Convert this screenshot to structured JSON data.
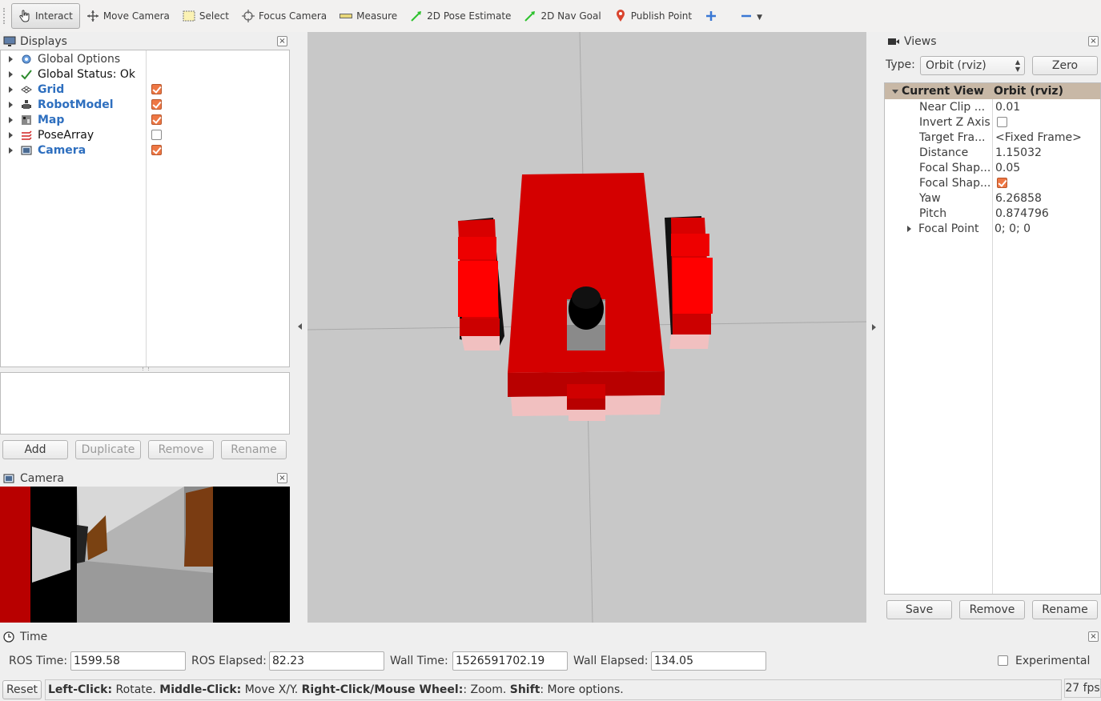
{
  "toolbar": {
    "tools": [
      {
        "label": "Interact",
        "icon": "hand-pointer-icon"
      },
      {
        "label": "Move Camera",
        "icon": "move-camera-icon"
      },
      {
        "label": "Select",
        "icon": "select-rect-icon"
      },
      {
        "label": "Focus Camera",
        "icon": "focus-camera-icon"
      },
      {
        "label": "Measure",
        "icon": "ruler-icon"
      },
      {
        "label": "2D Pose Estimate",
        "icon": "green-arrow-icon"
      },
      {
        "label": "2D Nav Goal",
        "icon": "green-arrow-icon"
      },
      {
        "label": "Publish Point",
        "icon": "map-pin-icon"
      }
    ]
  },
  "displays": {
    "title": "Displays",
    "items": [
      {
        "label": "Global Options",
        "icon": "gear-icon",
        "checked": null,
        "bold": false
      },
      {
        "label": "Global Status: Ok",
        "icon": "checkmark-icon",
        "checked": null,
        "bold": false
      },
      {
        "label": "Grid",
        "icon": "grid-icon",
        "checked": true,
        "bold": true
      },
      {
        "label": "RobotModel",
        "icon": "robot-icon",
        "checked": true,
        "bold": true
      },
      {
        "label": "Map",
        "icon": "map-icon",
        "checked": true,
        "bold": true
      },
      {
        "label": "PoseArray",
        "icon": "pose-array-icon",
        "checked": false,
        "bold": false
      },
      {
        "label": "Camera",
        "icon": "camera-icon",
        "checked": true,
        "bold": true
      }
    ],
    "buttons": {
      "add": "Add",
      "duplicate": "Duplicate",
      "remove": "Remove",
      "rename": "Rename"
    }
  },
  "camera_panel": {
    "title": "Camera"
  },
  "views": {
    "title": "Views",
    "type_label": "Type:",
    "type_value": "Orbit (rviz)",
    "zero": "Zero",
    "header": {
      "name": "Current View",
      "value": "Orbit (rviz)"
    },
    "props": [
      {
        "name": "Near Clip ...",
        "value": "0.01"
      },
      {
        "name": "Invert Z Axis",
        "value": ""
      },
      {
        "name": "Target Fra...",
        "value": "<Fixed Frame>"
      },
      {
        "name": "Distance",
        "value": "1.15032"
      },
      {
        "name": "Focal Shap...",
        "value": "0.05"
      },
      {
        "name": "Focal Shap...",
        "value": ""
      },
      {
        "name": "Yaw",
        "value": "6.26858"
      },
      {
        "name": "Pitch",
        "value": "0.874796"
      },
      {
        "name": "Focal Point",
        "value": "0; 0; 0"
      }
    ],
    "buttons": {
      "save": "Save",
      "remove": "Remove",
      "rename": "Rename"
    }
  },
  "time": {
    "title": "Time",
    "ros_time_label": "ROS Time:",
    "ros_time": "1599.58",
    "ros_elapsed_label": "ROS Elapsed:",
    "ros_elapsed": "82.23",
    "wall_time_label": "Wall Time:",
    "wall_time": "1526591702.19",
    "wall_elapsed_label": "Wall Elapsed:",
    "wall_elapsed": "134.05",
    "experimental": "Experimental"
  },
  "status": {
    "reset": "Reset",
    "hint_left_key": "Left-Click:",
    "hint_left": " Rotate. ",
    "hint_mid_key": "Middle-Click:",
    "hint_mid": " Move X/Y. ",
    "hint_right_key": "Right-Click/Mouse Wheel:",
    "hint_right": ": Zoom. ",
    "hint_shift_key": "Shift",
    "hint_shift": ": More options.",
    "fps": "27 fps"
  },
  "colors": {
    "robot_red": "#e00000",
    "checkbox_orange": "#ee7744",
    "selection_tan": "#c8b8a6"
  }
}
